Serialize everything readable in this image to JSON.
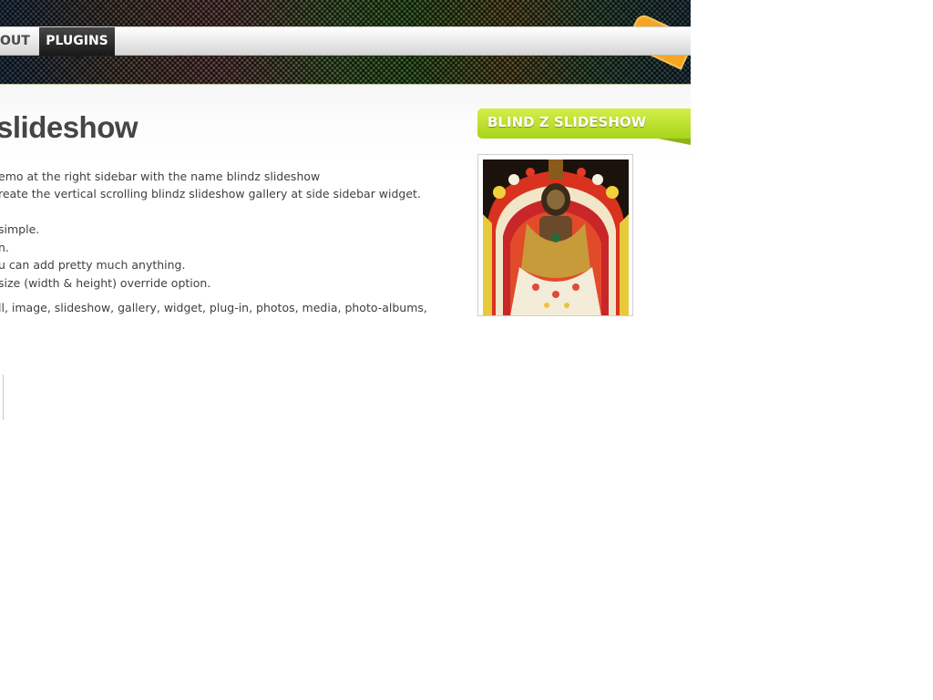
{
  "nav": {
    "items": [
      {
        "label": "OUT"
      },
      {
        "label": "PLUGINS"
      }
    ]
  },
  "page": {
    "title": "slideshow",
    "lines": [
      "emo at the right sidebar with the name blindz slideshow",
      "reate the vertical scrolling blindz slideshow gallery at side sidebar widget.",
      " simple.",
      "n.",
      "u can add pretty much anything.",
      "size (width & height) override option.",
      "ll, image, slideshow, gallery, widget, plug-in, photos, media, photo-albums,"
    ]
  },
  "sidebar": {
    "widget_title": "BLIND Z SLIDESHOW",
    "photo_icon": "temple-deity-garland-photo"
  },
  "colors": {
    "widget_accent": "#b5dc22",
    "nav_active": "#1f1f1f",
    "rss_orange": "#f5a623"
  }
}
